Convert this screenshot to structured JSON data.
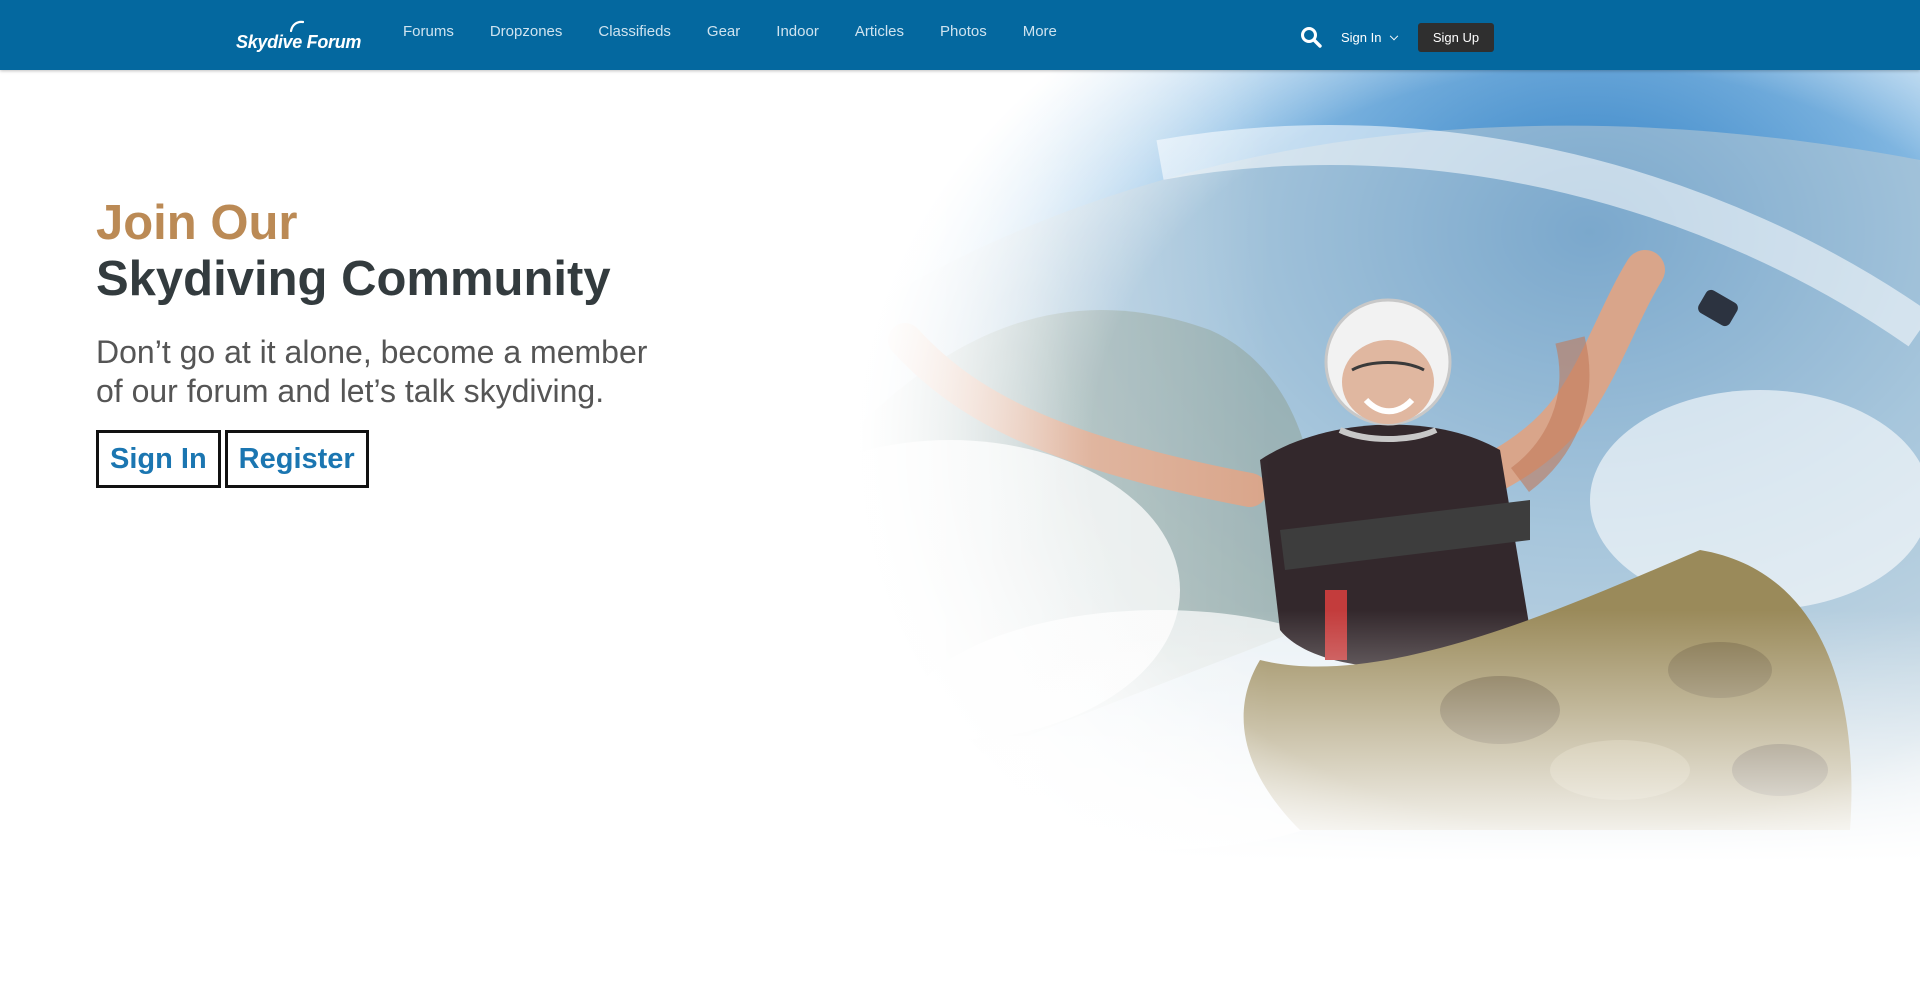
{
  "header": {
    "logo_text": "Skydive Forum",
    "nav": [
      "Forums",
      "Dropzones",
      "Classifieds",
      "Gear",
      "Indoor",
      "Articles",
      "Photos",
      "More"
    ],
    "signin_label": "Sign In",
    "signup_label": "Sign Up",
    "colors": {
      "bar": "#04689f",
      "signup_bg": "#2f2f2f"
    }
  },
  "hero": {
    "headline_line1": "Join Our",
    "headline_line2": "Skydiving Community",
    "subtext": "Don’t go at it alone, become a member of our forum and let’s talk skydiving.",
    "signin_button": "Sign In",
    "register_button": "Register",
    "colors": {
      "accent": "#bb8a55",
      "headline": "#333b3e",
      "link": "#1b76b1"
    }
  }
}
